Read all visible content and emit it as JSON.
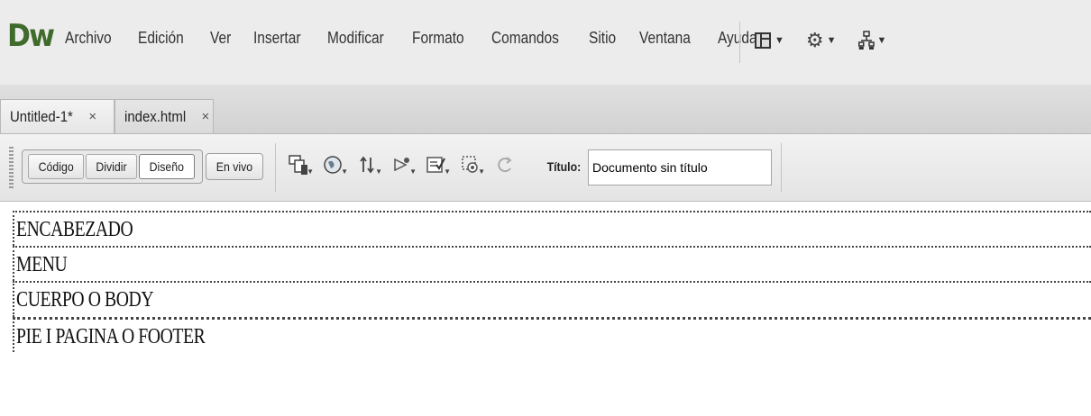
{
  "app": {
    "logo": "Dw"
  },
  "menu": {
    "items": [
      "Archivo",
      "Edición",
      "Ver",
      "Insertar",
      "Modificar",
      "Formato",
      "Comandos",
      "Sitio",
      "Ventana",
      "Ayuda"
    ],
    "tools": [
      "layout-icon",
      "gear-icon",
      "site-icon"
    ]
  },
  "tabs": [
    {
      "label": "Untitled-1*",
      "close": "×"
    },
    {
      "label": "index.html",
      "close": "×"
    }
  ],
  "toolbar": {
    "views": [
      "Código",
      "Dividir",
      "Diseño"
    ],
    "active_view": "Diseño",
    "live": "En vivo",
    "title_label": "Título:",
    "title_value": "Documento sin título",
    "icons": [
      "multiscreen-icon",
      "globe-preview-icon",
      "file-management-icon",
      "inspect-icon",
      "check-page-icon",
      "visual-aids-icon",
      "refresh-icon"
    ]
  },
  "design": {
    "blocks": [
      "ENCABEZADO",
      "MENU",
      "CUERPO O BODY",
      "PIE I PAGINA O FOOTER"
    ]
  }
}
